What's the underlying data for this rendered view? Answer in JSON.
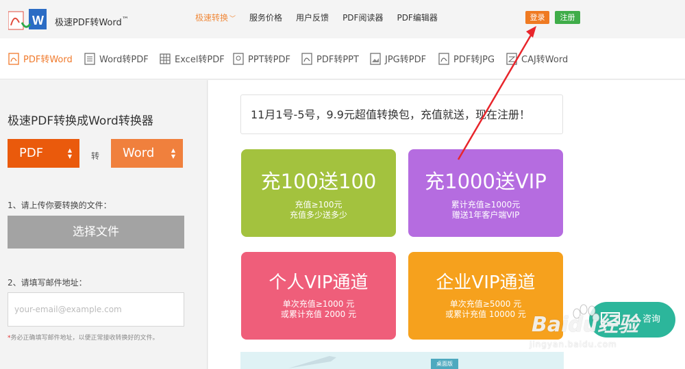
{
  "header": {
    "app_name": "极速PDF转Word",
    "trademark": "™",
    "nav": [
      {
        "label": "极速转换",
        "active": true
      },
      {
        "label": "服务价格",
        "active": false
      },
      {
        "label": "用户反馈",
        "active": false
      },
      {
        "label": "PDF阅读器",
        "active": false
      },
      {
        "label": "PDF编辑器",
        "active": false
      }
    ],
    "login_label": "登录",
    "register_label": "注册"
  },
  "tools": [
    {
      "label": "PDF转Word",
      "icon": "pdf-file-icon",
      "active": true
    },
    {
      "label": "Word转PDF",
      "icon": "word-file-icon",
      "active": false
    },
    {
      "label": "Excel转PDF",
      "icon": "excel-file-icon",
      "active": false
    },
    {
      "label": "PPT转PDF",
      "icon": "ppt-file-icon",
      "active": false
    },
    {
      "label": "PDF转PPT",
      "icon": "pdf-file-icon",
      "active": false
    },
    {
      "label": "JPG转PDF",
      "icon": "image-file-icon",
      "active": false
    },
    {
      "label": "PDF转JPG",
      "icon": "pdf-file-icon",
      "active": false
    },
    {
      "label": "CAJ转Word",
      "icon": "caj-file-icon",
      "active": false
    }
  ],
  "converter": {
    "title": "极速PDF转换成Word转换器",
    "from_format": "PDF",
    "to_format": "Word",
    "to_word": "转",
    "step1_label": "1、请上传你要转换的文件：",
    "choose_file_label": "选择文件",
    "step2_label": "2、请填写邮件地址：",
    "email_placeholder": "your-email@example.com",
    "note_star": "*",
    "note": "务必正确填写邮件地址，以便正常接收转换好的文件。"
  },
  "promo": {
    "banner": "11月1号-5号，9.9元超值转换包，充值就送，现在注册！",
    "cards": [
      {
        "title": "充100送100",
        "line1": "充值≥100元",
        "line2": "充值多少送多少"
      },
      {
        "title": "充1000送VIP",
        "line1": "累计充值≥1000元",
        "line2": "赠送1年客户端VIP"
      },
      {
        "title": "个人VIP通道",
        "line1": "单次充值≥1000 元",
        "line2": "或累计充值 2000 元"
      },
      {
        "title": "企业VIP通道",
        "line1": "单次充值≥5000 元",
        "line2": "或累计充值 10000 元"
      }
    ],
    "strip_tag": "桌面版"
  },
  "consult": {
    "label": "咨询"
  },
  "watermark": {
    "brand": "Baidu经验",
    "url": "jingyan.baidu.com"
  },
  "colors": {
    "accent": "#ef7a22",
    "green": "#3fad49",
    "arrow": "#e8252b"
  }
}
